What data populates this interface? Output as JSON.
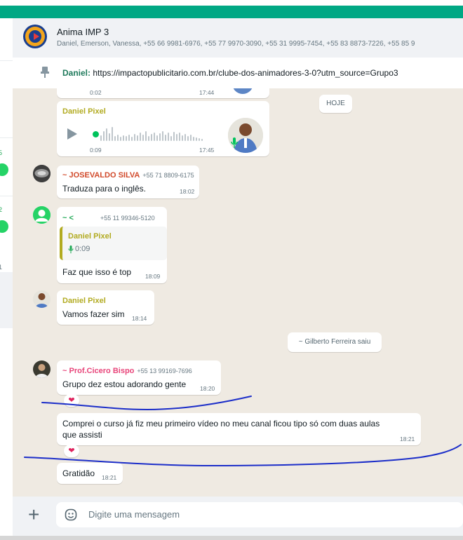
{
  "chat": {
    "name": "Anima IMP 3",
    "participants": "Daniel, Emerson, Vanessa, +55 66 9981-6976, +55 77 9970-3090, +55 31 9995-7454, +55 83 8873-7226, +55 85 9"
  },
  "pinned": {
    "sender": "Daniel:",
    "text": "https://impactopublicitario.com.br/clube-dos-animadores-3-0?utm_source=Grupo3"
  },
  "sidebar_fragments": {
    "count_1": "5",
    "count_2": "2",
    "count_3": "1"
  },
  "messages": {
    "prev_audio": {
      "duration": "0:02",
      "time": "17:44"
    },
    "day_label": "HOJE",
    "audio": {
      "sender": "Daniel Pixel",
      "duration": "0:09",
      "time": "17:45"
    },
    "josevaldo": {
      "sender": "~ JOSEVALDO SILVA",
      "phone": "+55 71 8809-6175",
      "text": "Traduza para o inglês.",
      "time": "18:02"
    },
    "reply": {
      "sender": "~ <",
      "phone": "+55 11 99346-5120",
      "quoted_sender": "Daniel Pixel",
      "quoted_duration": "0:09",
      "text": "Faz que isso é top",
      "time": "18:09"
    },
    "daniel2": {
      "sender": "Daniel Pixel",
      "text": "Vamos fazer sim",
      "time": "18:14"
    },
    "system": "~ Gilberto  Ferreira saiu",
    "cicero": {
      "sender": "~ Prof.Cicero Bispo",
      "phone": "+55 13 99169-7696",
      "text": "Grupo dez estou adorando gente",
      "time": "18:20",
      "reaction": "❤"
    },
    "long": {
      "line1": "Comprei o curso já fiz meu primeiro vídeo no meu canal ficou tipo só com duas aulas",
      "line2": "que assisti",
      "time": "18:21",
      "reaction": "❤"
    },
    "gratidao": {
      "text": "Gratidão",
      "time": "18:21"
    }
  },
  "composer": {
    "placeholder": "Digite uma mensagem",
    "plus": "+"
  },
  "icons": [
    "pin-icon",
    "play-icon",
    "mic-icon",
    "plus-icon",
    "emoji-icon"
  ],
  "colors": {
    "accent": "#00a884",
    "chat_bg": "#efeae2",
    "sender_daniel": "#b2ab21",
    "sender_josevaldo": "#d1492a",
    "sender_cicero": "#e8457a",
    "annotation_ink": "#1c2ec9"
  }
}
